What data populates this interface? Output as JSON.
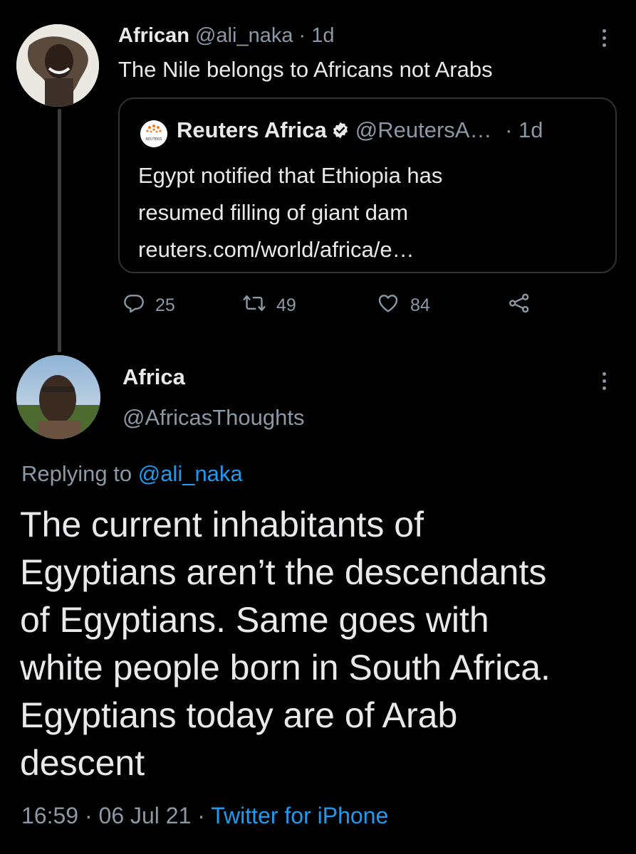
{
  "tweet1": {
    "display_name": "African",
    "handle": "@ali_naka",
    "time_sep": " · ",
    "age": "1d",
    "text": "The Nile belongs to Africans not Arabs",
    "quote": {
      "display_name": "Reuters Africa",
      "handle": "@ReutersA…",
      "age": "· 1d",
      "avatar_text": "REUTERS",
      "lines": [
        "Egypt notified that Ethiopia has",
        "resumed filling of giant dam",
        "reuters.com/world/africa/e…"
      ]
    },
    "actions": {
      "replies": "25",
      "retweets": "49",
      "likes": "84"
    }
  },
  "tweet2": {
    "display_name": "Africa",
    "handle": "@AfricasThoughts",
    "replying_prefix": "Replying to ",
    "replying_to": "@ali_naka",
    "lines": [
      "The current inhabitants of",
      "Egyptians aren’t the descendants",
      "of Egyptians. Same goes with",
      "white people born in South Africa.",
      "Egyptians today are of Arab",
      "descent"
    ],
    "timestamp": "16:59 · 06 Jul 21 · ",
    "source": "Twitter for iPhone"
  },
  "colors": {
    "background": "#000000",
    "text": "#e7e9ea",
    "muted": "#8b98a5",
    "link": "#1d9bf0",
    "border": "#2f3336"
  },
  "icons": [
    "more-vertical-icon",
    "verified-badge-icon",
    "reply-icon",
    "retweet-icon",
    "like-icon",
    "share-icon"
  ]
}
